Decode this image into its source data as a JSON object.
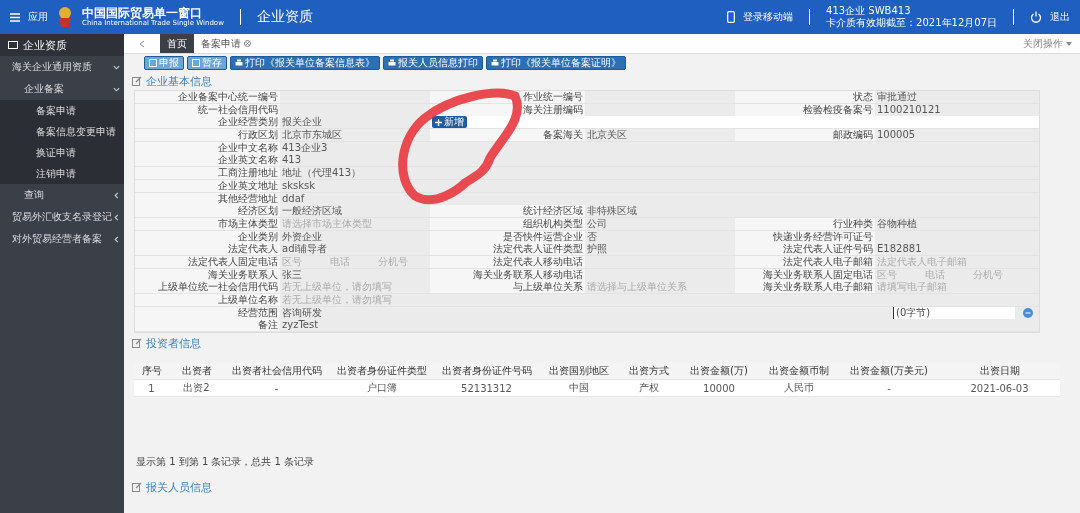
{
  "header": {
    "menu_label": "应用",
    "logo_title": "中国国际贸易单一窗口",
    "logo_subtitle": "China International Trade Single Window",
    "module": "企业资质",
    "mobile_login": "登录移动端",
    "user": "413企业 SWB413",
    "card_expiry": "卡介质有效期截至：2021年12月07日",
    "logout": "退出"
  },
  "sidebar": {
    "title": "企业资质",
    "items": [
      {
        "label": "海关企业通用资质",
        "expanded": true,
        "children": [
          {
            "label": "企业备案",
            "expanded": true,
            "children": [
              {
                "label": "备案申请"
              },
              {
                "label": "备案信息变更申请"
              },
              {
                "label": "换证申请"
              },
              {
                "label": "注销申请"
              }
            ]
          },
          {
            "label": "查询",
            "expanded": false
          }
        ]
      },
      {
        "label": "贸易外汇收支名录登记",
        "expanded": false
      },
      {
        "label": "对外贸易经营者备案",
        "expanded": false
      }
    ]
  },
  "tabs": [
    {
      "label": "首页",
      "selected": true,
      "closable": false
    },
    {
      "label": "备案申请",
      "selected": false,
      "closable": true
    }
  ],
  "tab_actions": "关闭操作",
  "toolbar": [
    {
      "label": "申报",
      "kind": "save"
    },
    {
      "label": "暂存",
      "kind": "save"
    },
    {
      "label": "打印《报关单位备案信息表》",
      "kind": "print"
    },
    {
      "label": "报关人员信息打印",
      "kind": "print"
    },
    {
      "label": "打印《报关单位备案证明》",
      "kind": "print"
    }
  ],
  "basic_info": {
    "title": "企业基本信息",
    "rows": [
      [
        {
          "kind": "text",
          "label": "企业备案中心统一编号"
        },
        {
          "kind": "text",
          "label": "作业统一编号"
        },
        {
          "kind": "text",
          "label": "状态",
          "value": "审批通过"
        }
      ],
      [
        {
          "kind": "text",
          "label": "统一社会信用代码"
        },
        {
          "kind": "text",
          "label": "海关注册编码"
        },
        {
          "kind": "text",
          "label": "检验检疫备案号",
          "value": "1100210121"
        }
      ],
      [
        {
          "kind": "text",
          "label": "企业经营类别",
          "value": "报关企业"
        },
        {
          "kind": "button",
          "label": "新增"
        }
      ],
      [
        {
          "kind": "text",
          "label": "行政区划",
          "value": "北京市东城区"
        },
        {
          "kind": "text",
          "label": "备案海关",
          "value": "北京关区"
        },
        {
          "kind": "text",
          "label": "邮政编码",
          "value": "100005"
        }
      ],
      [
        {
          "kind": "text",
          "label": "企业中文名称",
          "value": "413企业3"
        }
      ],
      [
        {
          "kind": "text",
          "label": "企业英文名称",
          "value": "413"
        }
      ],
      [
        {
          "kind": "text",
          "label": "工商注册地址",
          "value": "地址（代理413）"
        }
      ],
      [
        {
          "kind": "text",
          "label": "企业英文地址",
          "value": "sksksk"
        }
      ],
      [
        {
          "kind": "text",
          "label": "其他经营地址",
          "value": "ddaf"
        }
      ],
      [
        {
          "kind": "text",
          "label": "经济区划",
          "value": "一般经济区域"
        },
        {
          "kind": "text",
          "label": "统计经济区域",
          "value": "非特殊区域"
        }
      ],
      [
        {
          "kind": "text",
          "label": "市场主体类型",
          "placeholder": "请选择市场主体类型"
        },
        {
          "kind": "text",
          "label": "组织机构类型",
          "value": "公司"
        },
        {
          "kind": "text",
          "label": "行业种类",
          "value": "谷物种植"
        }
      ],
      [
        {
          "kind": "text",
          "label": "企业类别",
          "value": "外资企业"
        },
        {
          "kind": "text",
          "label": "是否快件运营企业",
          "value": "否"
        },
        {
          "kind": "text",
          "label": "快递业务经营许可证号"
        }
      ],
      [
        {
          "kind": "text",
          "label": "法定代表人",
          "value": "adi辅导者"
        },
        {
          "kind": "text",
          "label": "法定代表人证件类型",
          "value": "护照"
        },
        {
          "kind": "text",
          "label": "法定代表人证件号码",
          "value": "E182881"
        }
      ],
      [
        {
          "kind": "phone",
          "label": "法定代表人固定电话",
          "placeholders": [
            "区号",
            "电话",
            "分机号"
          ]
        },
        {
          "kind": "text",
          "label": "法定代表人移动电话"
        },
        {
          "kind": "text",
          "label": "法定代表人电子邮箱",
          "placeholder": "法定代表人电子邮箱"
        }
      ],
      [
        {
          "kind": "text",
          "label": "海关业务联系人",
          "value": "张三"
        },
        {
          "kind": "text",
          "label": "海关业务联系人移动电话"
        },
        {
          "kind": "phone",
          "label": "海关业务联系人固定电话",
          "placeholders": [
            "区号",
            "电话",
            "分机号"
          ]
        }
      ],
      [
        {
          "kind": "text",
          "label": "上级单位统一社会信用代码",
          "placeholder": "若无上级单位，请勿填写"
        },
        {
          "kind": "text",
          "label": "与上级单位关系",
          "placeholder": "请选择与上级单位关系"
        },
        {
          "kind": "text",
          "label": "海关业务联系人电子邮箱",
          "placeholder": "请填写电子邮箱"
        }
      ],
      [
        {
          "kind": "text",
          "label": "上级单位名称",
          "placeholder": "若无上级单位，请勿填写"
        }
      ],
      [
        {
          "kind": "textarea",
          "label": "经营范围",
          "value": "咨询研发",
          "counter": "(0字节)"
        }
      ],
      [
        {
          "kind": "text",
          "label": "备注",
          "value": "zyzTest"
        }
      ]
    ]
  },
  "investors": {
    "title": "投资者信息",
    "columns": [
      "序号",
      "出资者",
      "出资者社会信用代码",
      "出资者身份证件类型",
      "出资者身份证件号码",
      "出资国别地区",
      "出资方式",
      "出资金额(万)",
      "出资金额币制",
      "出资金额(万美元)",
      "出资日期"
    ],
    "rows": [
      [
        "1",
        "出资2",
        "-",
        "户口簿",
        "52131312",
        "中国",
        "产权",
        "10000",
        "人民币",
        "-",
        "2021-06-03"
      ]
    ],
    "summary": "显示第 1 到第 1 条记录，总共 1 条记录"
  },
  "customs_staff": {
    "title": "报关人员信息"
  }
}
